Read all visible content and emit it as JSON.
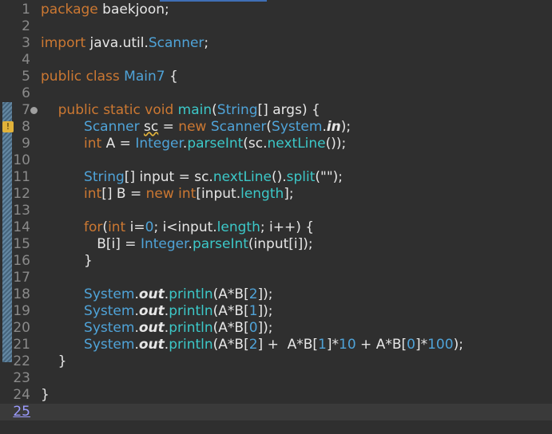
{
  "editor": {
    "current_line": "25",
    "lines": [
      {
        "n": "1",
        "text": "package baekjoon;"
      },
      {
        "n": "2",
        "text": ""
      },
      {
        "n": "3",
        "text": "import java.util.Scanner;"
      },
      {
        "n": "4",
        "text": ""
      },
      {
        "n": "5",
        "text": "public class Main7 {"
      },
      {
        "n": "6",
        "text": ""
      },
      {
        "n": "7",
        "text": "    public static void main(String[] args) {"
      },
      {
        "n": "8",
        "text": "          Scanner sc = new Scanner(System.in);"
      },
      {
        "n": "9",
        "text": "          int A = Integer.parseInt(sc.nextLine());"
      },
      {
        "n": "10",
        "text": ""
      },
      {
        "n": "11",
        "text": "          String[] input = sc.nextLine().split(\"\");"
      },
      {
        "n": "12",
        "text": "          int[] B = new int[input.length];"
      },
      {
        "n": "13",
        "text": ""
      },
      {
        "n": "14",
        "text": "          for(int i=0; i<input.length; i++) {"
      },
      {
        "n": "15",
        "text": "             B[i] = Integer.parseInt(input[i]);"
      },
      {
        "n": "16",
        "text": "          }"
      },
      {
        "n": "17",
        "text": ""
      },
      {
        "n": "18",
        "text": "          System.out.println(A*B[2]);"
      },
      {
        "n": "19",
        "text": "          System.out.println(A*B[1]);"
      },
      {
        "n": "20",
        "text": "          System.out.println(A*B[0]);"
      },
      {
        "n": "21",
        "text": "          System.out.println(A*B[2] +  A*B[1]*10 + A*B[0]*100);"
      },
      {
        "n": "22",
        "text": "    }"
      },
      {
        "n": "23",
        "text": ""
      },
      {
        "n": "24",
        "text": "}"
      },
      {
        "n": "25",
        "text": ""
      }
    ]
  },
  "icons": {
    "fold": "fold-toggle-icon",
    "warning": "warning-icon"
  },
  "colors": {
    "background": "#2f2f2f",
    "keyword": "#cc7832",
    "type": "#4fa3d8",
    "method": "#3cc8c8",
    "text": "#e6e6e6"
  }
}
